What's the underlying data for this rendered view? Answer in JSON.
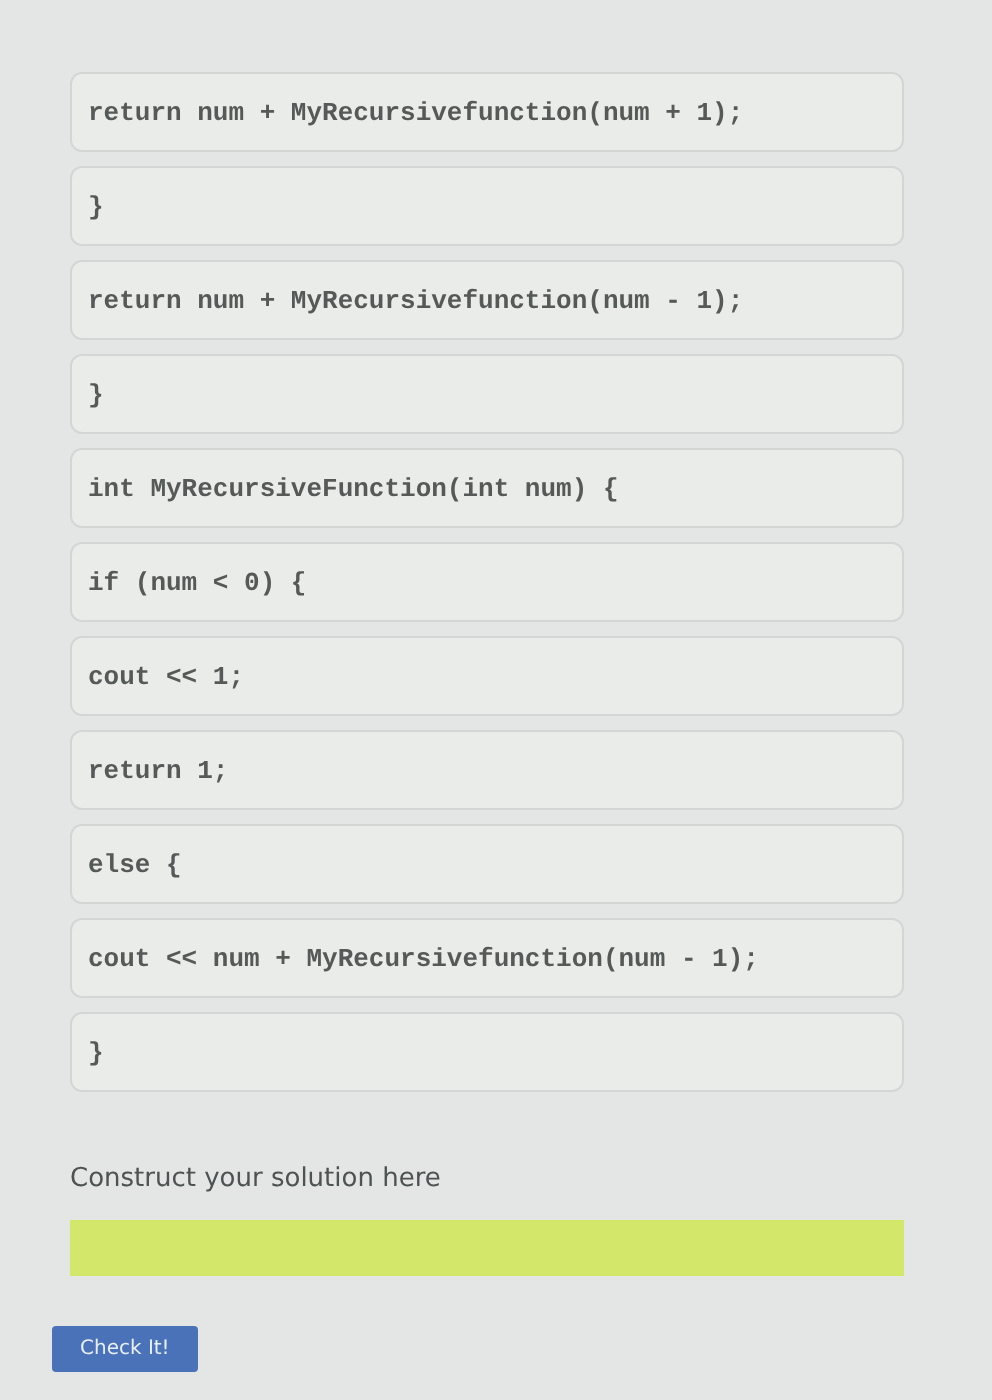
{
  "code_blocks": [
    {
      "code": "return num + MyRecursivefunction(num + 1);"
    },
    {
      "code": "}"
    },
    {
      "code": "return num + MyRecursivefunction(num - 1);"
    },
    {
      "code": "}"
    },
    {
      "code": "int MyRecursiveFunction(int num) {"
    },
    {
      "code": "if (num < 0) {"
    },
    {
      "code": "cout << 1;"
    },
    {
      "code": "return 1;"
    },
    {
      "code": "else {"
    },
    {
      "code": "cout << num + MyRecursivefunction(num - 1);"
    },
    {
      "code": "}"
    }
  ],
  "solution": {
    "prompt": "Construct your solution here"
  },
  "check_button": "Check It!"
}
